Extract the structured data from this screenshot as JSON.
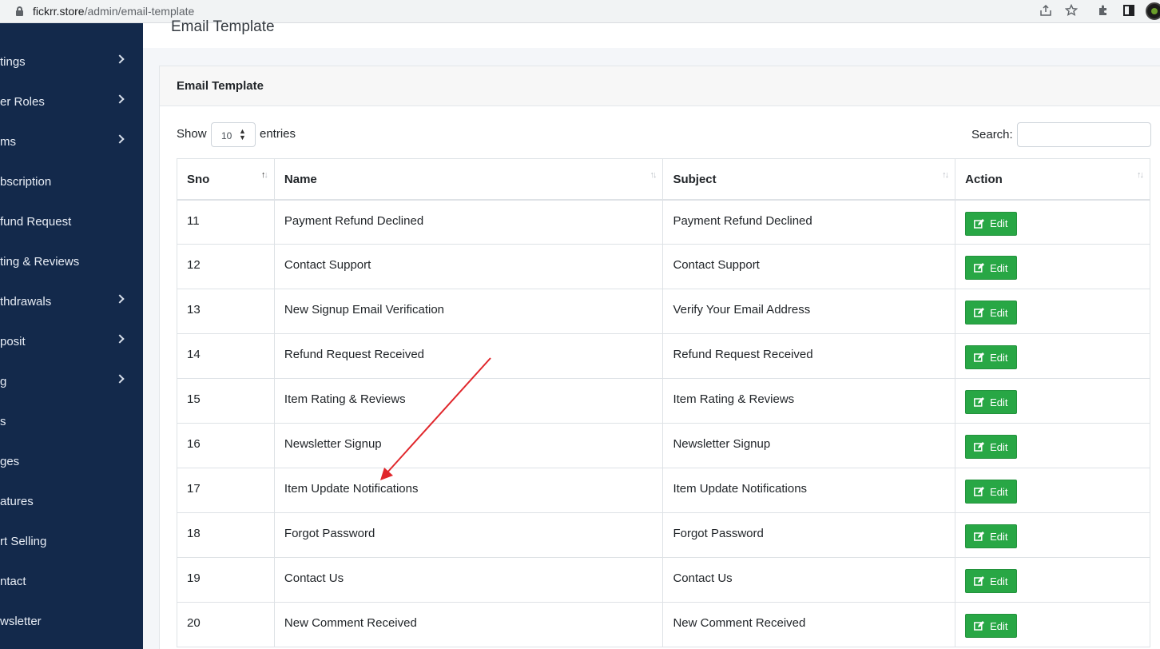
{
  "browser": {
    "url_host": "fickrr.store",
    "url_path": "/admin/email-template",
    "icons": [
      "lock-icon",
      "share-icon",
      "star-icon",
      "extensions-icon",
      "side-panel-icon",
      "profile-avatar"
    ]
  },
  "sidebar": {
    "items": [
      {
        "label": "tings",
        "has_chevron": true
      },
      {
        "label": "er Roles",
        "has_chevron": true
      },
      {
        "label": "ms",
        "has_chevron": true
      },
      {
        "label": "bscription",
        "has_chevron": false
      },
      {
        "label": "fund Request",
        "has_chevron": false
      },
      {
        "label": "ting & Reviews",
        "has_chevron": false
      },
      {
        "label": "thdrawals",
        "has_chevron": true
      },
      {
        "label": "posit",
        "has_chevron": true
      },
      {
        "label": "g",
        "has_chevron": true
      },
      {
        "label": "s",
        "has_chevron": false
      },
      {
        "label": "ges",
        "has_chevron": false
      },
      {
        "label": "atures",
        "has_chevron": false
      },
      {
        "label": "rt Selling",
        "has_chevron": false
      },
      {
        "label": "ntact",
        "has_chevron": false
      },
      {
        "label": "wsletter",
        "has_chevron": false
      }
    ]
  },
  "page": {
    "title": "Email Template"
  },
  "card": {
    "title": "Email Template",
    "show_label": "Show",
    "entries_value": "10",
    "entries_label": "entries",
    "search_label": "Search:",
    "search_value": ""
  },
  "table": {
    "headers": [
      "Sno",
      "Name",
      "Subject",
      "Action"
    ],
    "rows": [
      {
        "sno": "11",
        "name": "Payment Refund Declined",
        "subject": "Payment Refund Declined",
        "action": "Edit"
      },
      {
        "sno": "12",
        "name": "Contact Support",
        "subject": "Contact Support",
        "action": "Edit"
      },
      {
        "sno": "13",
        "name": "New Signup Email Verification",
        "subject": "Verify Your Email Address",
        "action": "Edit"
      },
      {
        "sno": "14",
        "name": "Refund Request Received",
        "subject": "Refund Request Received",
        "action": "Edit"
      },
      {
        "sno": "15",
        "name": "Item Rating & Reviews",
        "subject": "Item Rating & Reviews",
        "action": "Edit"
      },
      {
        "sno": "16",
        "name": "Newsletter Signup",
        "subject": "Newsletter Signup",
        "action": "Edit"
      },
      {
        "sno": "17",
        "name": "Item Update Notifications",
        "subject": "Item Update Notifications",
        "action": "Edit"
      },
      {
        "sno": "18",
        "name": "Forgot Password",
        "subject": "Forgot Password",
        "action": "Edit"
      },
      {
        "sno": "19",
        "name": "Contact Us",
        "subject": "Contact Us",
        "action": "Edit"
      },
      {
        "sno": "20",
        "name": "New Comment Received",
        "subject": "New Comment Received",
        "action": "Edit"
      }
    ]
  },
  "colors": {
    "sidebar_bg": "#13294b",
    "edit_button": "#28a745",
    "annotation_arrow": "#e0262b"
  }
}
